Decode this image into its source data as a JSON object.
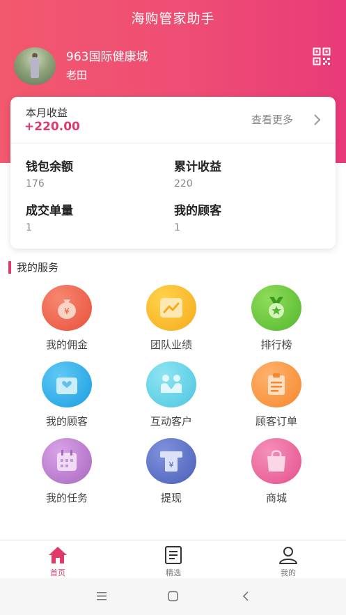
{
  "header": {
    "app_title": "海购管家助手",
    "store_name": "963国际健康城",
    "user_name": "老田"
  },
  "earnings": {
    "month_label": "本月收益",
    "month_value": "+220.00",
    "more_label": "查看更多"
  },
  "stats": [
    {
      "title": "钱包余额",
      "value": "176"
    },
    {
      "title": "累计收益",
      "value": "220"
    },
    {
      "title": "成交单量",
      "value": "1"
    },
    {
      "title": "我的顾客",
      "value": "1"
    }
  ],
  "services": {
    "section_title": "我的服务",
    "items": [
      {
        "label": "我的佣金",
        "icon": "money-bag-icon"
      },
      {
        "label": "团队业绩",
        "icon": "trend-chart-icon"
      },
      {
        "label": "排行榜",
        "icon": "medal-icon"
      },
      {
        "label": "我的顾客",
        "icon": "customer-heart-icon"
      },
      {
        "label": "互动客户",
        "icon": "handshake-icon"
      },
      {
        "label": "顾客订单",
        "icon": "order-list-icon"
      },
      {
        "label": "我的任务",
        "icon": "calendar-icon"
      },
      {
        "label": "提现",
        "icon": "withdraw-atm-icon"
      },
      {
        "label": "商城",
        "icon": "shopping-bag-icon"
      }
    ]
  },
  "tabbar": {
    "items": [
      {
        "label": "首页",
        "icon": "home-icon",
        "active": true
      },
      {
        "label": "精选",
        "icon": "document-icon",
        "active": false
      },
      {
        "label": "我的",
        "icon": "user-icon",
        "active": false
      }
    ]
  },
  "colors": {
    "brand": "#ee4d74",
    "accent_text": "#e03a6a"
  }
}
